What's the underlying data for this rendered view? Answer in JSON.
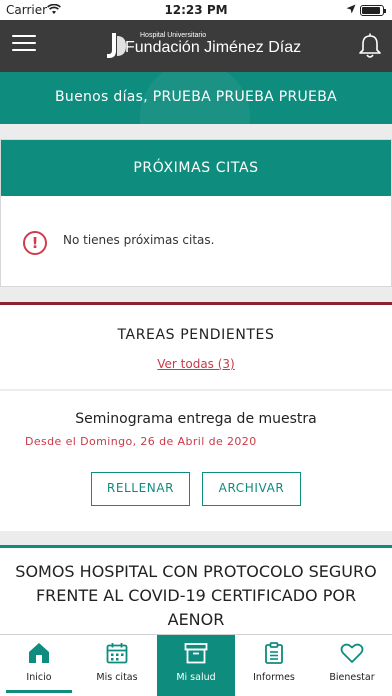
{
  "status_bar": {
    "carrier": "Carrier",
    "time": "12:23 PM"
  },
  "header": {
    "logo_small": "Hospital Universitario",
    "logo_main": "Fundación Jiménez Díaz"
  },
  "greeting": "Buenos días, PRUEBA PRUEBA PRUEBA",
  "citas": {
    "title": "PRÓXIMAS CITAS",
    "empty_message": "No tienes próximas citas."
  },
  "tareas": {
    "title": "TAREAS PENDIENTES",
    "see_all": "Ver todas (3)"
  },
  "task": {
    "title": "Seminograma entrega de muestra",
    "date": "Desde el Domingo, 26 de Abril de 2020",
    "fill_label": "RELLENAR",
    "archive_label": "ARCHIVAR"
  },
  "promo": {
    "text": "SOMOS HOSPITAL CON PROTOCOLO SEGURO FRENTE AL COVID-19 CERTIFICADO POR AENOR"
  },
  "tabs": [
    {
      "label": "Inicio",
      "icon": "home-icon"
    },
    {
      "label": "Mis citas",
      "icon": "calendar-icon"
    },
    {
      "label": "Mi salud",
      "icon": "box-icon"
    },
    {
      "label": "Informes",
      "icon": "clipboard-icon"
    },
    {
      "label": "Bienestar",
      "icon": "heart-icon"
    }
  ],
  "colors": {
    "teal": "#0e8c7e",
    "dark_header": "#3b3b3b",
    "accent_red": "#c93b48",
    "maroon": "#8d2331"
  }
}
